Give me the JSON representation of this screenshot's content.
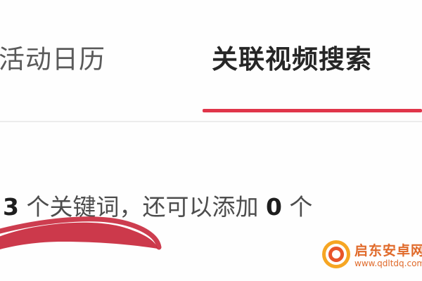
{
  "tabs": [
    {
      "label": "活动日历",
      "active": false
    },
    {
      "label": "关联视频搜索",
      "active": true
    }
  ],
  "keywords": {
    "count": "3",
    "text_middle": " 个关键词，还可以添加 ",
    "remaining": "0",
    "text_tail": " 个"
  },
  "watermark": {
    "name": "启东安卓网",
    "url": "www.qdltdq.com"
  },
  "colors": {
    "accent": "#e0354a",
    "annotation": "#c8283c",
    "watermark": "#e06a2a"
  }
}
